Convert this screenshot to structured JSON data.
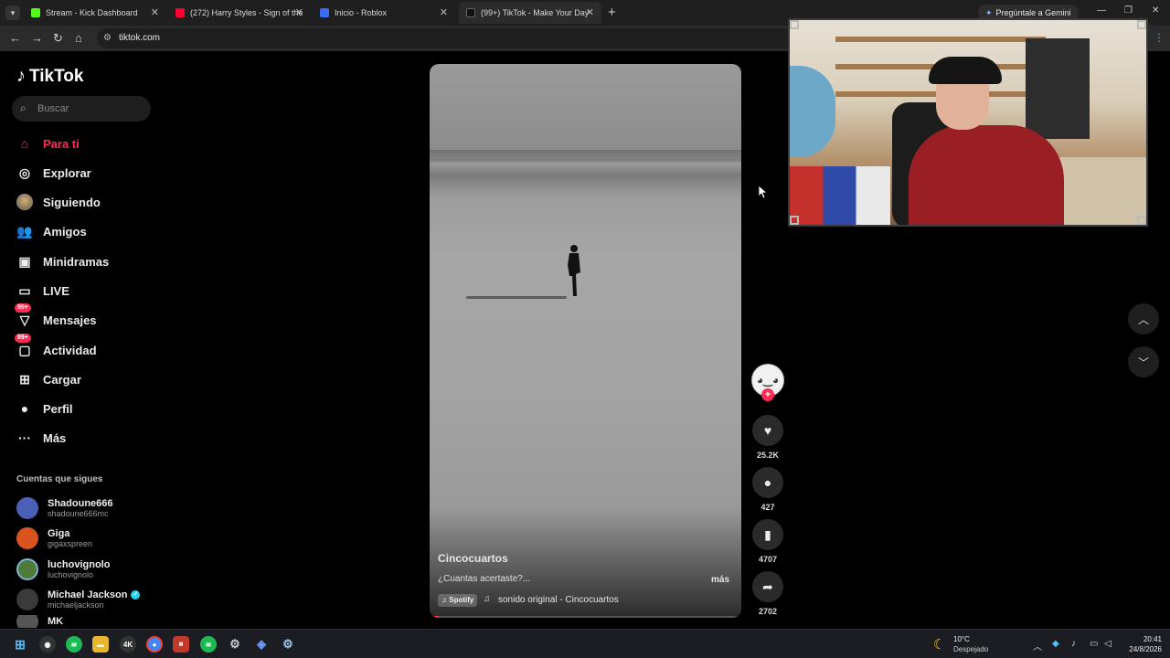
{
  "browser": {
    "tabs": [
      {
        "title": "Stream - Kick Dashboard",
        "favicon_color": "#53fc18"
      },
      {
        "title": "(272) Harry Styles - Sign of the",
        "favicon_color": "#ff0033"
      },
      {
        "title": "Inicio - Roblox",
        "favicon_color": "#3b6cf6"
      },
      {
        "title": "(99+) TikTok - Make Your Day",
        "favicon_color": "#111111"
      }
    ],
    "active_tab_index": 3,
    "gemini_label": "Pregúntale a Gemini",
    "url": "tiktok.com"
  },
  "sidebar": {
    "logo": "TikTok",
    "search_placeholder": "Buscar",
    "nav": [
      {
        "label": "Para ti",
        "icon": "home-icon",
        "active": true
      },
      {
        "label": "Explorar",
        "icon": "compass-icon"
      },
      {
        "label": "Siguiendo",
        "icon": "avatar-icon"
      },
      {
        "label": "Amigos",
        "icon": "friends-icon"
      },
      {
        "label": "Minidramas",
        "icon": "film-icon"
      },
      {
        "label": "LIVE",
        "icon": "live-tv-icon"
      },
      {
        "label": "Mensajes",
        "icon": "message-icon",
        "badge": "99+"
      },
      {
        "label": "Actividad",
        "icon": "activity-icon",
        "badge": "99+"
      },
      {
        "label": "Cargar",
        "icon": "upload-icon"
      },
      {
        "label": "Perfil",
        "icon": "profile-icon"
      },
      {
        "label": "Más",
        "icon": "more-icon"
      }
    ],
    "following_title": "Cuentas que sigues",
    "following": [
      {
        "name": "Shadoune666",
        "handle": "shadoune666mc",
        "color": "#4a5fb5"
      },
      {
        "name": "Giga",
        "handle": "gigaxspreen",
        "color": "#d9531e"
      },
      {
        "name": "luchovignolo",
        "handle": "luchovignolo",
        "color": "#4f7a3a"
      },
      {
        "name": "Michael Jackson",
        "handle": "michaeljackson",
        "verified": true,
        "color": "#3a3a3a"
      },
      {
        "name": "MK",
        "handle": "",
        "color": "#555555"
      }
    ]
  },
  "video": {
    "author": "Cincocuartos",
    "caption": "¿Cuantas acertaste?...",
    "more_label": "más",
    "spotify_label": "Spotify",
    "sound": "sonido original - Cincocuartos",
    "progress": 0.03
  },
  "actions": {
    "likes": "25.2K",
    "comments": "427",
    "saves": "4707",
    "shares": "2702"
  },
  "taskbar": {
    "temperature": "10°C",
    "weather": "Despejado",
    "time": "20:41",
    "date": "24/8/2026"
  },
  "colors": {
    "accent": "#fe2c55",
    "background": "#000000"
  }
}
